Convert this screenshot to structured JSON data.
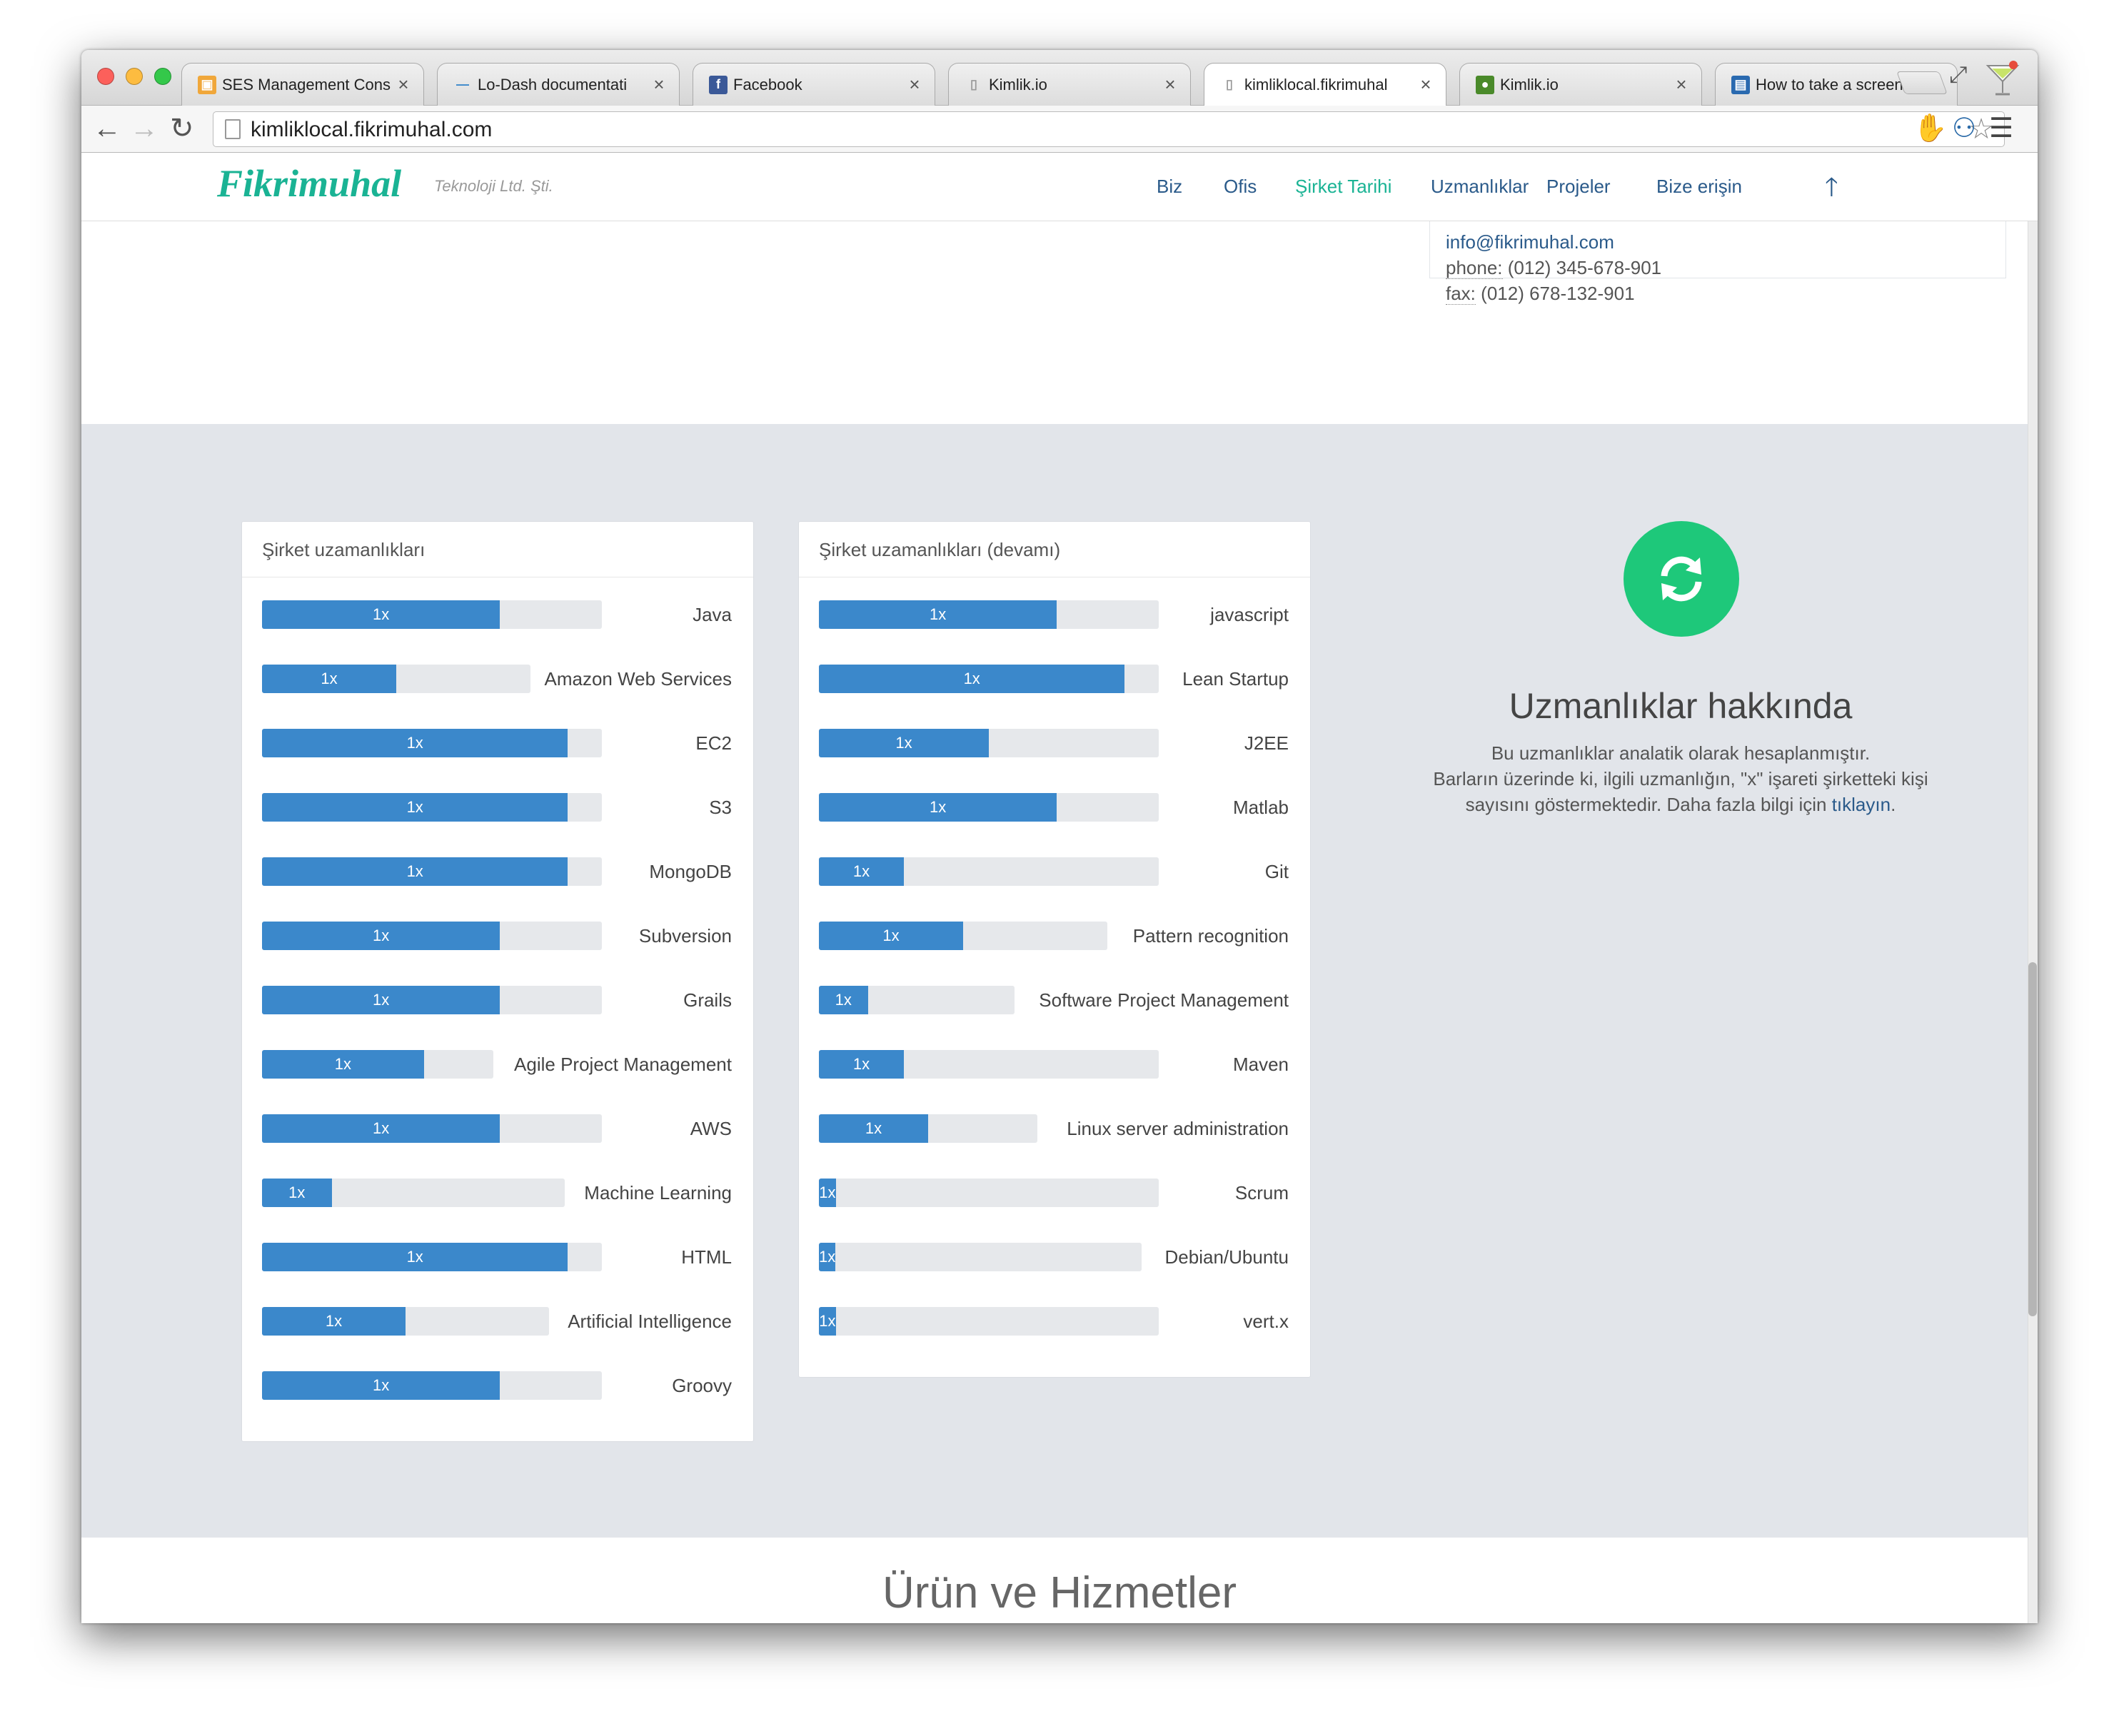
{
  "browser": {
    "tabs": [
      {
        "title": "SES Management Cons",
        "icon": "aws-box-icon",
        "active": false
      },
      {
        "title": "Lo-Dash documentati",
        "icon": "lodash-icon",
        "active": false
      },
      {
        "title": "Facebook",
        "icon": "facebook-icon",
        "active": false
      },
      {
        "title": "Kimlik.io",
        "icon": "page-icon",
        "active": false
      },
      {
        "title": "kimliklocal.fikrimuhal",
        "icon": "page-icon",
        "active": true
      },
      {
        "title": "Kimlik.io",
        "icon": "green-logo-icon",
        "active": false
      },
      {
        "title": "How to take a screens",
        "icon": "screenshot-icon",
        "active": false
      }
    ],
    "close_glyph": "×",
    "url": "kimliklocal.fikrimuhal.com",
    "colors": {
      "close": "#fc605b",
      "minimize": "#fdbc40",
      "zoom": "#34c84a"
    }
  },
  "nav": {
    "logo": "Fikrimuhal",
    "tagline": "Teknoloji Ltd. Şti.",
    "items": [
      "Biz",
      "Ofis",
      "Şirket Tarihi",
      "Uzmanlıklar",
      "Projeler",
      "Bize erişin"
    ],
    "active_item": "Şirket Tarihi",
    "up_icon": "arrow-up-icon"
  },
  "contact": {
    "email": "info@fikrimuhal.com",
    "phone_label": "phone:",
    "phone": "(012) 345-678-901",
    "fax_label": "fax:",
    "fax": "(012) 678-132-901"
  },
  "skills_left": {
    "title": "Şirket uzamanlıkları",
    "items": [
      {
        "label": "Java",
        "count": "1x",
        "fill": 0.7
      },
      {
        "label": "Amazon Web Services",
        "count": "1x",
        "fill": 0.5
      },
      {
        "label": "EC2",
        "count": "1x",
        "fill": 0.9
      },
      {
        "label": "S3",
        "count": "1x",
        "fill": 0.9
      },
      {
        "label": "MongoDB",
        "count": "1x",
        "fill": 0.9
      },
      {
        "label": "Subversion",
        "count": "1x",
        "fill": 0.7
      },
      {
        "label": "Grails",
        "count": "1x",
        "fill": 0.7
      },
      {
        "label": "Agile Project Management",
        "count": "1x",
        "fill": 0.7
      },
      {
        "label": "AWS",
        "count": "1x",
        "fill": 0.7
      },
      {
        "label": "Machine Learning",
        "count": "1x",
        "fill": 0.23
      },
      {
        "label": "HTML",
        "count": "1x",
        "fill": 0.9
      },
      {
        "label": "Artificial Intelligence",
        "count": "1x",
        "fill": 0.5
      },
      {
        "label": "Groovy",
        "count": "1x",
        "fill": 0.7
      }
    ]
  },
  "skills_right": {
    "title": "Şirket uzamanlıkları (devamı)",
    "items": [
      {
        "label": "javascript",
        "count": "1x",
        "fill": 0.7
      },
      {
        "label": "Lean Startup",
        "count": "1x",
        "fill": 0.9
      },
      {
        "label": "J2EE",
        "count": "1x",
        "fill": 0.5
      },
      {
        "label": "Matlab",
        "count": "1x",
        "fill": 0.7
      },
      {
        "label": "Git",
        "count": "1x",
        "fill": 0.25
      },
      {
        "label": "Pattern recognition",
        "count": "1x",
        "fill": 0.5
      },
      {
        "label": "Software Project Management",
        "count": "1x",
        "fill": 0.25
      },
      {
        "label": "Maven",
        "count": "1x",
        "fill": 0.25
      },
      {
        "label": "Linux server administration",
        "count": "1x",
        "fill": 0.5
      },
      {
        "label": "Scrum",
        "count": "1x",
        "fill": 0.05
      },
      {
        "label": "Debian/Ubuntu",
        "count": "1x",
        "fill": 0.05
      },
      {
        "label": "vert.x",
        "count": "1x",
        "fill": 0.05
      }
    ]
  },
  "about": {
    "icon": "refresh-icon",
    "title": "Uzmanlıklar hakkında",
    "line1": "Bu uzmanlıklar analatik olarak hesaplanmıştır.",
    "line2": "Barların üzerinde ki, ilgili uzmanlığın, \"x\" işareti şirketteki kişi",
    "line3_prefix": "sayısını göstermektedir. Daha fazla bilgi için ",
    "link": "tıklayın",
    "line3_suffix": "."
  },
  "products": {
    "title": "Ürün ve Hizmetler"
  }
}
